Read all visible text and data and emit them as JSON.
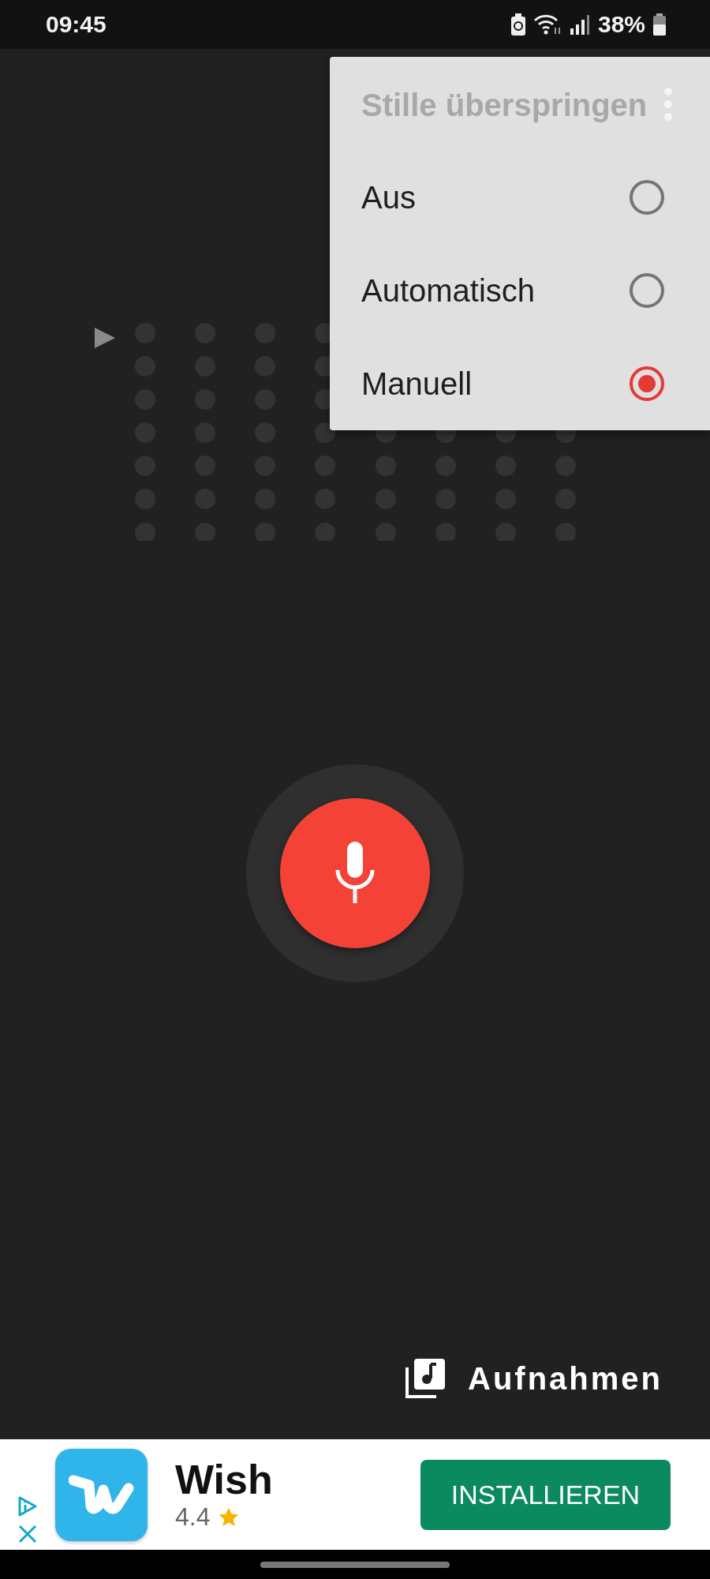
{
  "status_bar": {
    "time": "09:45",
    "battery": "38%"
  },
  "menu": {
    "title": "Stille überspringen",
    "options": [
      {
        "label": "Aus",
        "selected": false
      },
      {
        "label": "Automatisch",
        "selected": false
      },
      {
        "label": "Manuell",
        "selected": true
      }
    ]
  },
  "recordings_button": {
    "label": "Aufnahmen"
  },
  "ad": {
    "app_name": "Wish",
    "rating": "4.4",
    "button": "INSTALLIEREN"
  }
}
